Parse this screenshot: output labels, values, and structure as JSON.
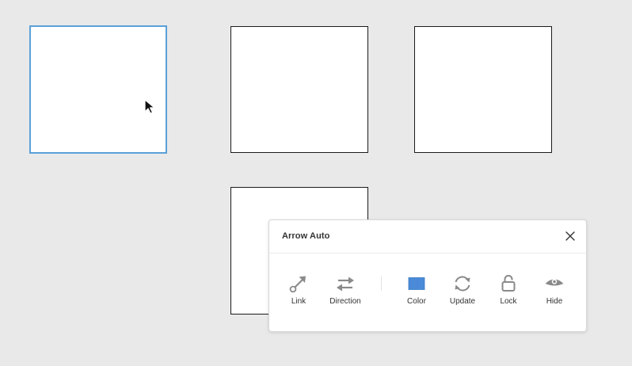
{
  "panel": {
    "title": "Arrow Auto",
    "accent_color": "#4a8ad8"
  },
  "tools": [
    {
      "label": "Link",
      "icon": "link-arrow-icon"
    },
    {
      "label": "Direction",
      "icon": "swap-direction-icon"
    },
    {
      "label": "Color",
      "icon": "color-swatch-icon"
    },
    {
      "label": "Update",
      "icon": "refresh-icon"
    },
    {
      "label": "Lock",
      "icon": "unlock-icon"
    },
    {
      "label": "Hide",
      "icon": "eye-icon"
    }
  ],
  "colors": {
    "selection": "#5aa0d8",
    "icon": "#8a8a8a",
    "canvas": "#e9e9e9"
  }
}
